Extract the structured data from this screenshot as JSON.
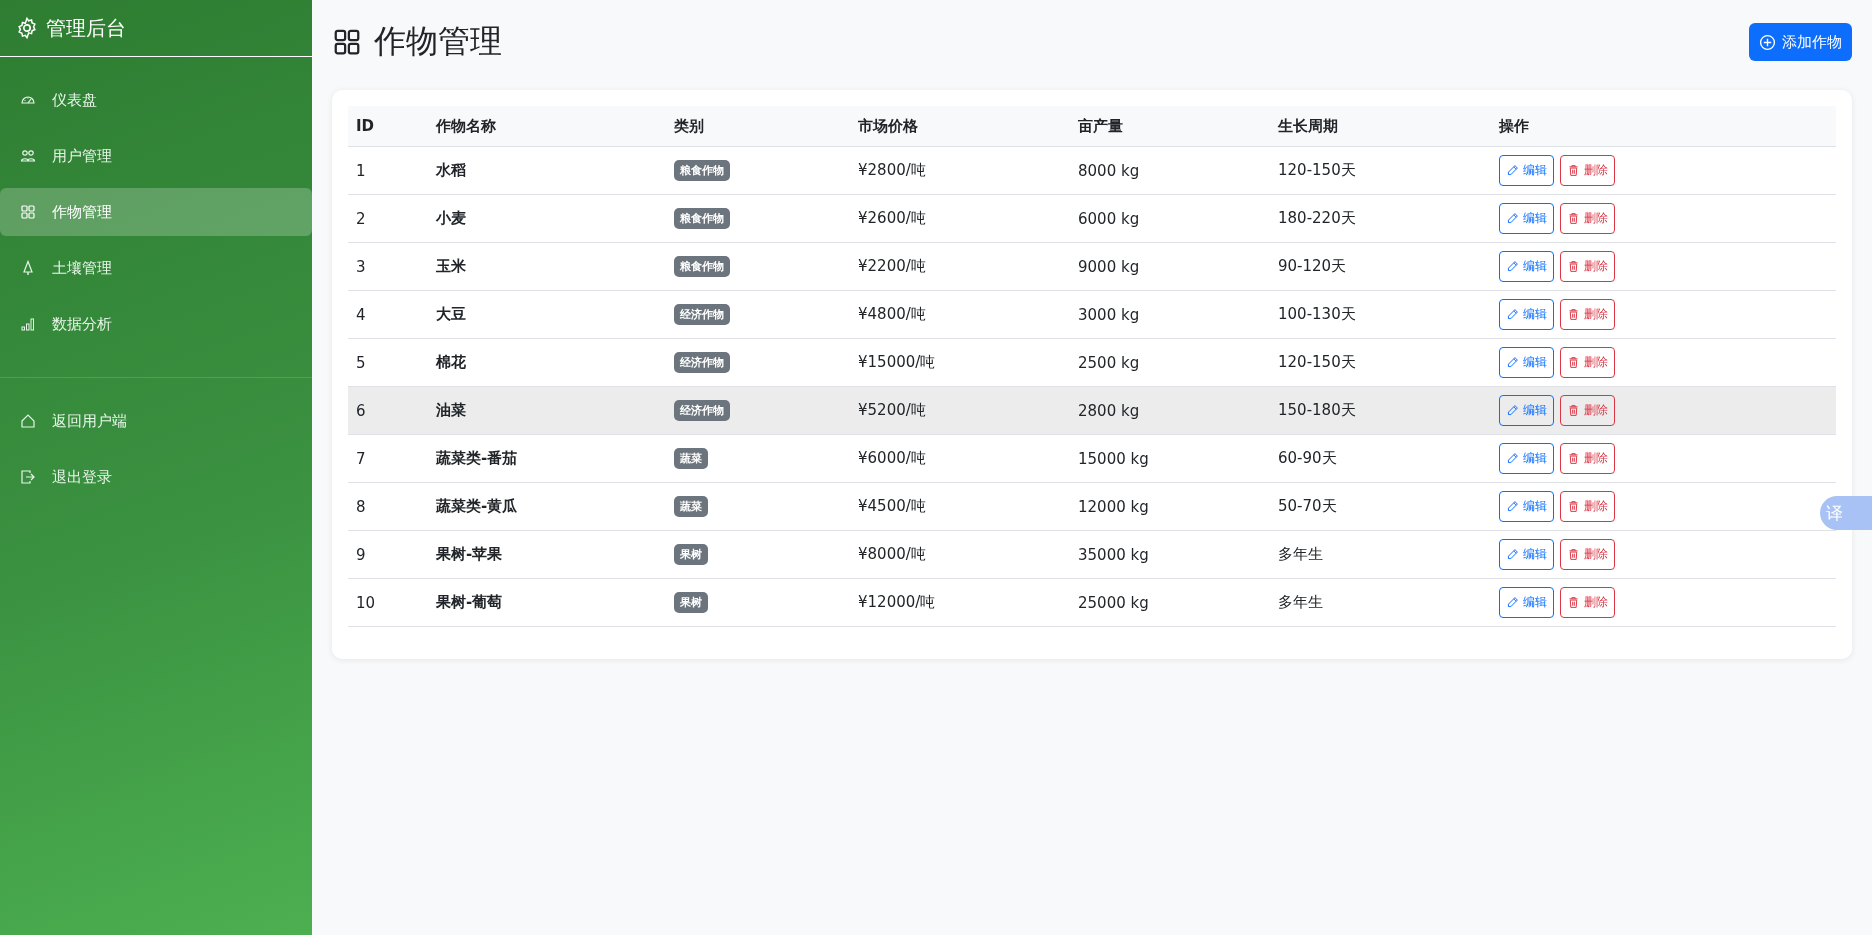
{
  "sidebar": {
    "brand": "管理后台",
    "items": [
      {
        "label": "仪表盘",
        "selected": false
      },
      {
        "label": "用户管理",
        "selected": false
      },
      {
        "label": "作物管理",
        "selected": true
      },
      {
        "label": "土壤管理",
        "selected": false
      },
      {
        "label": "数据分析",
        "selected": false
      }
    ],
    "bottom_items": [
      {
        "label": "返回用户端"
      },
      {
        "label": "退出登录"
      }
    ]
  },
  "page": {
    "title": "作物管理",
    "add_button": "添加作物"
  },
  "table": {
    "columns": [
      "ID",
      "作物名称",
      "类别",
      "市场价格",
      "亩产量",
      "生长周期",
      "操作"
    ],
    "rows": [
      {
        "id": "1",
        "name": "水稻",
        "category": "粮食作物",
        "price": "¥2800/吨",
        "yield": "8000 kg",
        "cycle": "120-150天",
        "edit": "编辑",
        "delete": "删除",
        "highlighted": false
      },
      {
        "id": "2",
        "name": "小麦",
        "category": "粮食作物",
        "price": "¥2600/吨",
        "yield": "6000 kg",
        "cycle": "180-220天",
        "edit": "编辑",
        "delete": "删除",
        "highlighted": false
      },
      {
        "id": "3",
        "name": "玉米",
        "category": "粮食作物",
        "price": "¥2200/吨",
        "yield": "9000 kg",
        "cycle": "90-120天",
        "edit": "编辑",
        "delete": "删除",
        "highlighted": false
      },
      {
        "id": "4",
        "name": "大豆",
        "category": "经济作物",
        "price": "¥4800/吨",
        "yield": "3000 kg",
        "cycle": "100-130天",
        "edit": "编辑",
        "delete": "删除",
        "highlighted": false
      },
      {
        "id": "5",
        "name": "棉花",
        "category": "经济作物",
        "price": "¥15000/吨",
        "yield": "2500 kg",
        "cycle": "120-150天",
        "edit": "编辑",
        "delete": "删除",
        "highlighted": false
      },
      {
        "id": "6",
        "name": "油菜",
        "category": "经济作物",
        "price": "¥5200/吨",
        "yield": "2800 kg",
        "cycle": "150-180天",
        "edit": "编辑",
        "delete": "删除",
        "highlighted": true
      },
      {
        "id": "7",
        "name": "蔬菜类-番茄",
        "category": "蔬菜",
        "price": "¥6000/吨",
        "yield": "15000 kg",
        "cycle": "60-90天",
        "edit": "编辑",
        "delete": "删除",
        "highlighted": false
      },
      {
        "id": "8",
        "name": "蔬菜类-黄瓜",
        "category": "蔬菜",
        "price": "¥4500/吨",
        "yield": "12000 kg",
        "cycle": "50-70天",
        "edit": "编辑",
        "delete": "删除",
        "highlighted": false
      },
      {
        "id": "9",
        "name": "果树-苹果",
        "category": "果树",
        "price": "¥8000/吨",
        "yield": "35000 kg",
        "cycle": "多年生",
        "edit": "编辑",
        "delete": "删除",
        "highlighted": false
      },
      {
        "id": "10",
        "name": "果树-葡萄",
        "category": "果树",
        "price": "¥12000/吨",
        "yield": "25000 kg",
        "cycle": "多年生",
        "edit": "编辑",
        "delete": "删除",
        "highlighted": false
      }
    ]
  },
  "translate_button": "译"
}
